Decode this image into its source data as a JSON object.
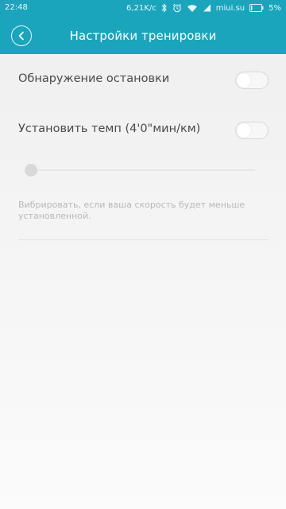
{
  "status_bar": {
    "time": "22:48",
    "network_speed": "6,21K/c",
    "carrier": "miui.su",
    "battery": "5%",
    "icons": [
      "bluetooth-icon",
      "alarm-icon",
      "wifi-icon",
      "signal-icon",
      "battery-icon"
    ]
  },
  "header": {
    "title": "Настройки тренировки",
    "back_icon": "chevron-left-icon",
    "accent_color": "#1aa5bd"
  },
  "settings": {
    "stop_detection": {
      "label": "Обнаружение остановки",
      "enabled": false
    },
    "set_pace": {
      "label": "Установить темп (4'0\"мин/км)",
      "enabled": false
    },
    "pace_slider": {
      "value": 0
    },
    "hint": "Вибрировать, если ваша скорость будет меньше установленной."
  }
}
